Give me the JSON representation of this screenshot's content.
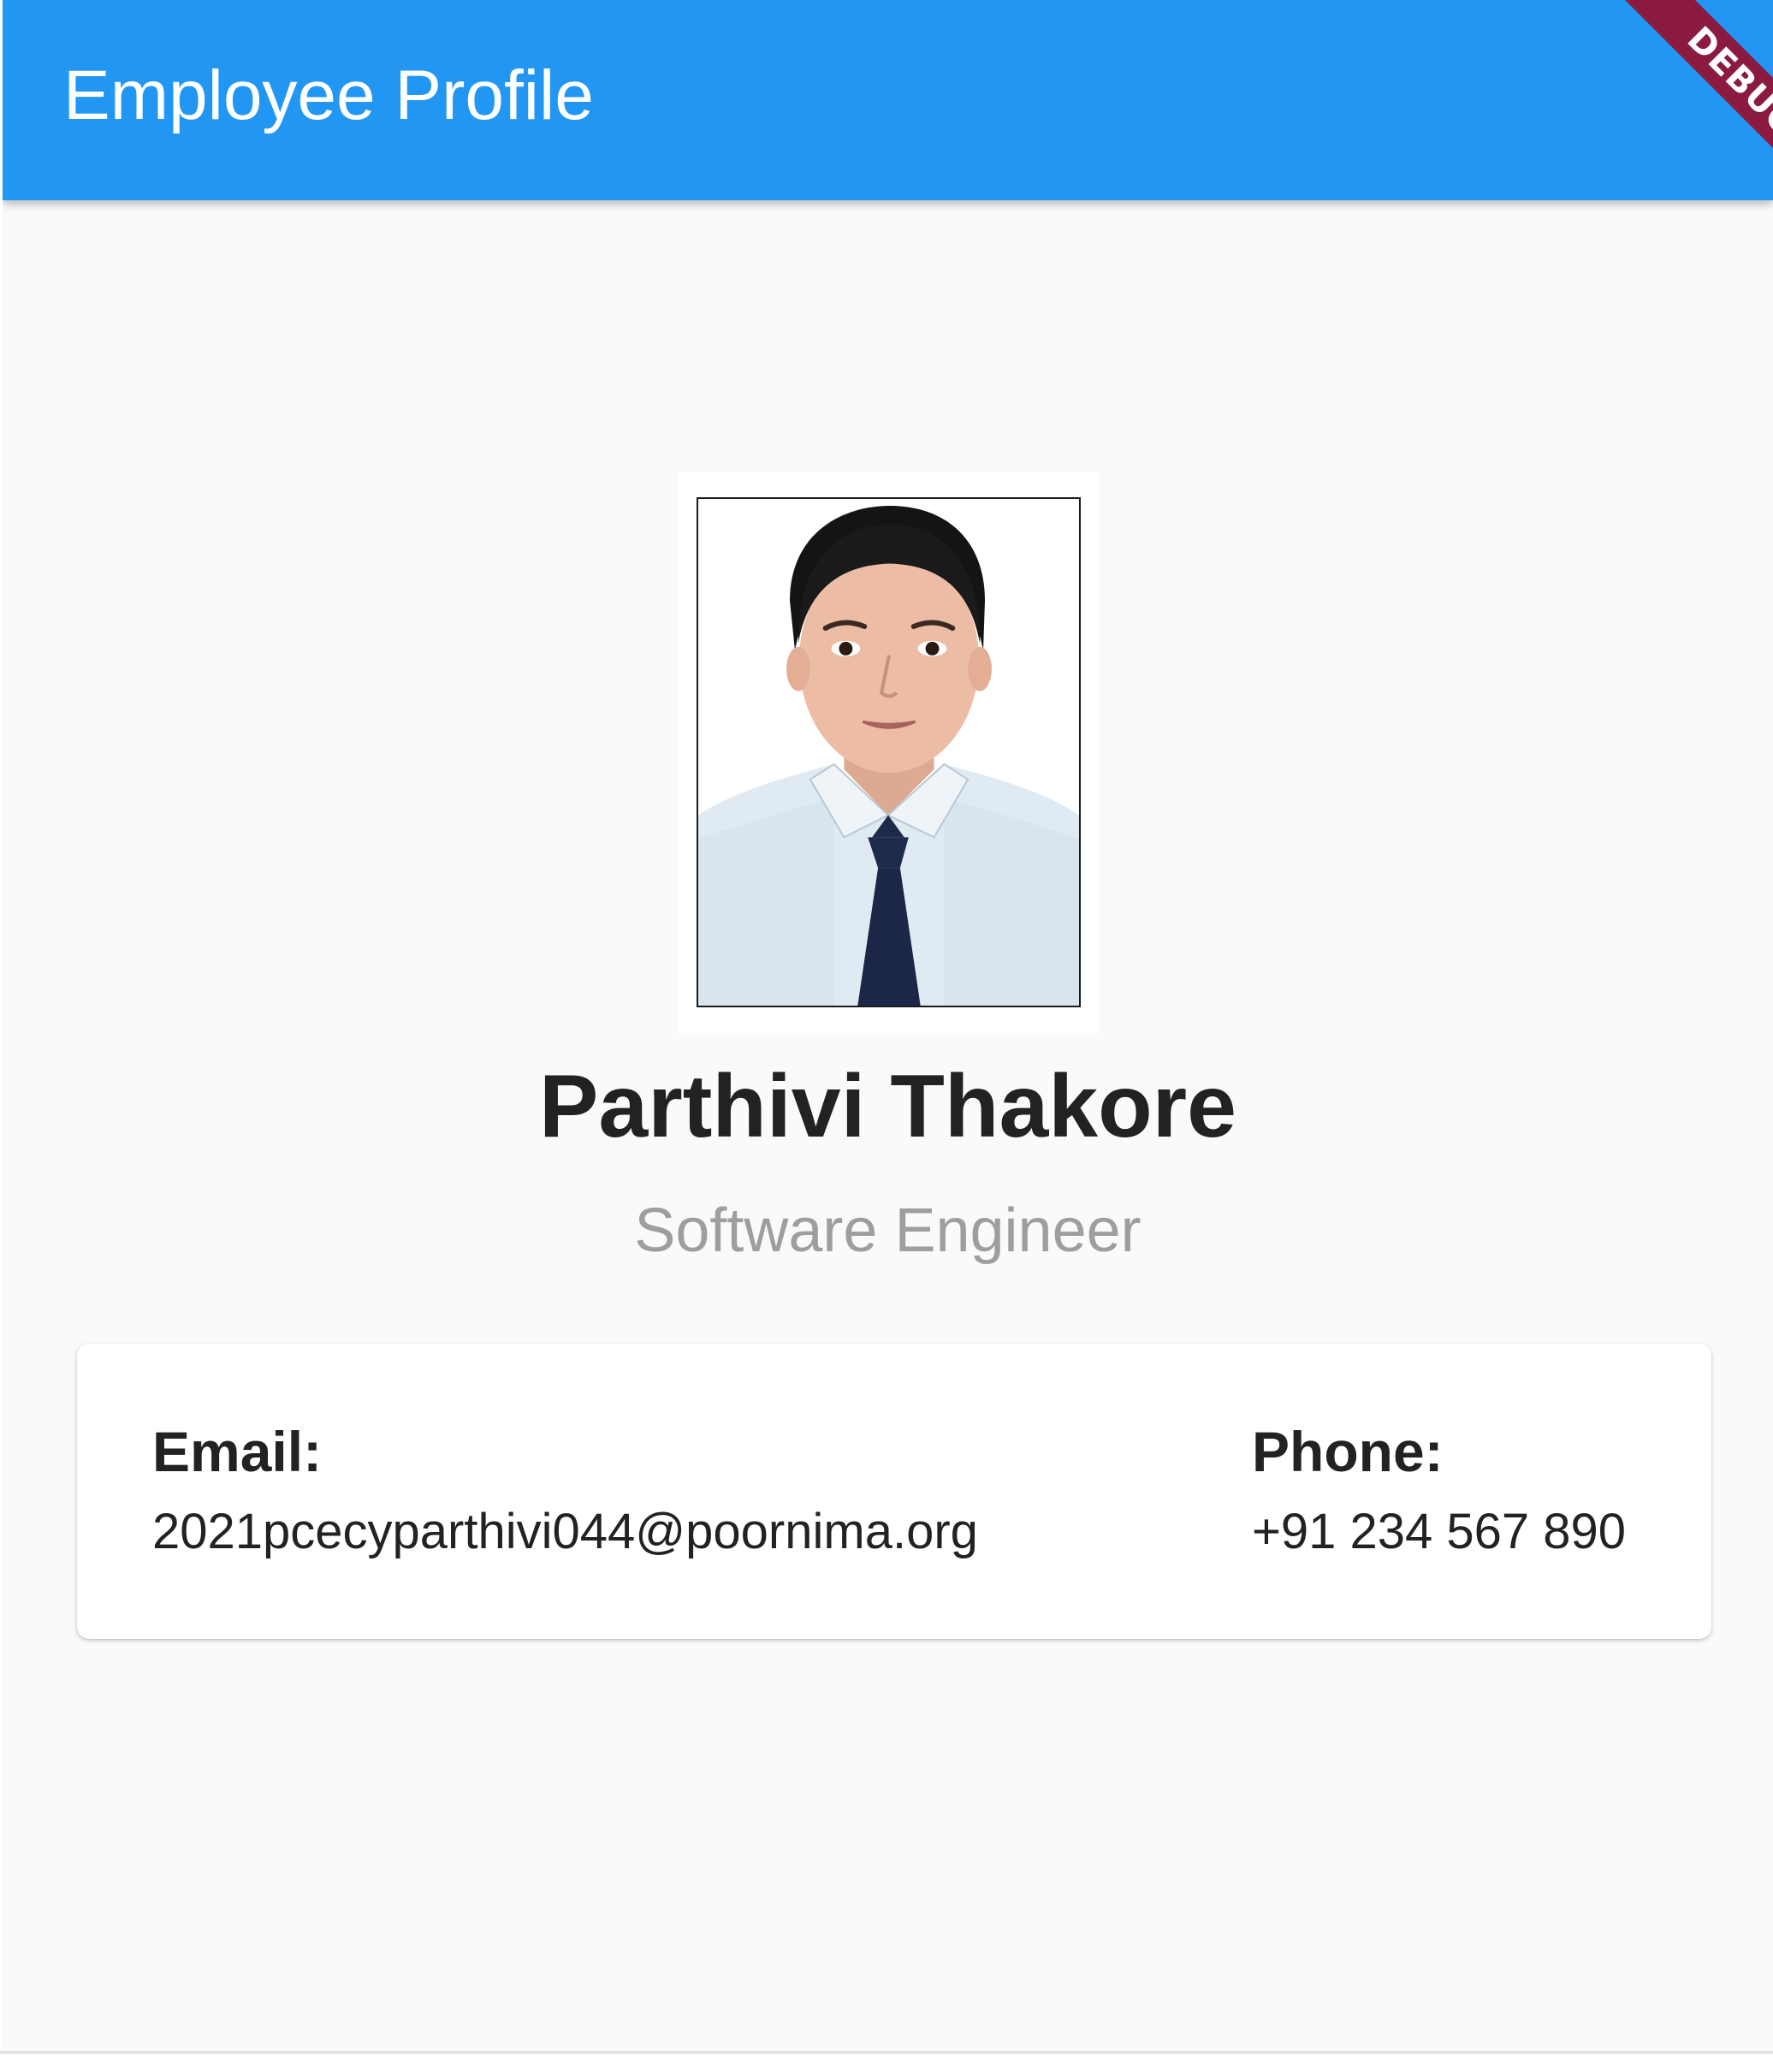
{
  "app_bar": {
    "title": "Employee Profile",
    "background": "#2196f3"
  },
  "debug_banner": {
    "label": "DEBUG",
    "color": "#8a1b3f"
  },
  "profile": {
    "photo_icon": "profile-photo",
    "name": "Parthivi Thakore",
    "job_title": "Software Engineer"
  },
  "contact": {
    "email_label": "Email:",
    "email_value": "2021pcecyparthivi044@poornima.org",
    "phone_label": "Phone:",
    "phone_value": "+91 234 567 890"
  }
}
